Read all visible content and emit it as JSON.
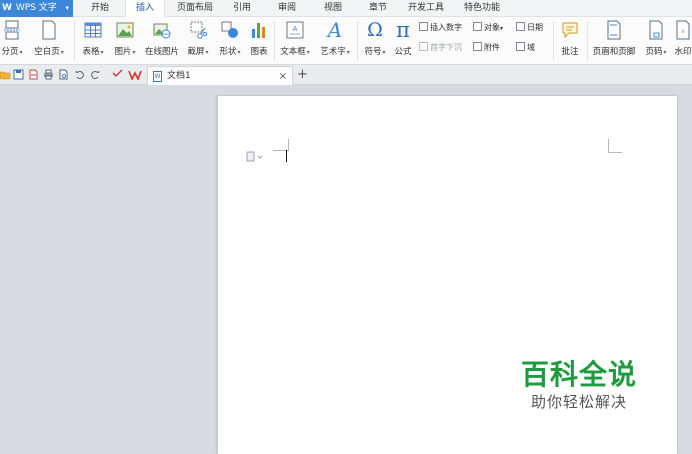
{
  "app": {
    "logo": "W",
    "name": "WPS 文字",
    "menu_arrow": "▾"
  },
  "menu": {
    "tabs": [
      "开始",
      "插入",
      "页面布局",
      "引用",
      "审阅",
      "视图",
      "章节",
      "开发工具",
      "特色功能"
    ],
    "active": "插入"
  },
  "ribbon": {
    "buttons": {
      "page_break": "分页",
      "blank_page": "空白页",
      "table": "表格",
      "picture": "图片",
      "online_picture": "在线图片",
      "screenshot": "截屏",
      "shapes": "形状",
      "chart": "图表",
      "textbox": "文本框",
      "wordart": "艺术字",
      "symbol": "符号",
      "formula": "公式",
      "comment": "批注",
      "header_footer": "页眉和页脚",
      "page_number": "页码",
      "watermark": "水印"
    },
    "small": {
      "insert_number": "插入数字",
      "object": "对象",
      "date": "日期",
      "drop_cap": "首字下沉",
      "attachment": "附件",
      "field": "域"
    },
    "glyphs": {
      "omega": "Ω",
      "pi": "π",
      "wordart_a": "A",
      "dropdown": "▾"
    }
  },
  "tabbar": {
    "doc_name": "文档1",
    "close": "×",
    "new_tab": "+",
    "quick_icons": [
      "folder-icon",
      "save-icon",
      "export-pdf-icon",
      "print-icon",
      "print-preview-icon",
      "undo-icon",
      "redo-icon",
      "format-painter-icon",
      "wps-icon"
    ]
  },
  "watermark": {
    "title": "百科全说",
    "subtitle": "助你轻松解决"
  },
  "colors": {
    "accent": "#3d87d8",
    "brand_green": "#1f9b3f",
    "workspace": "#d7dadf"
  }
}
